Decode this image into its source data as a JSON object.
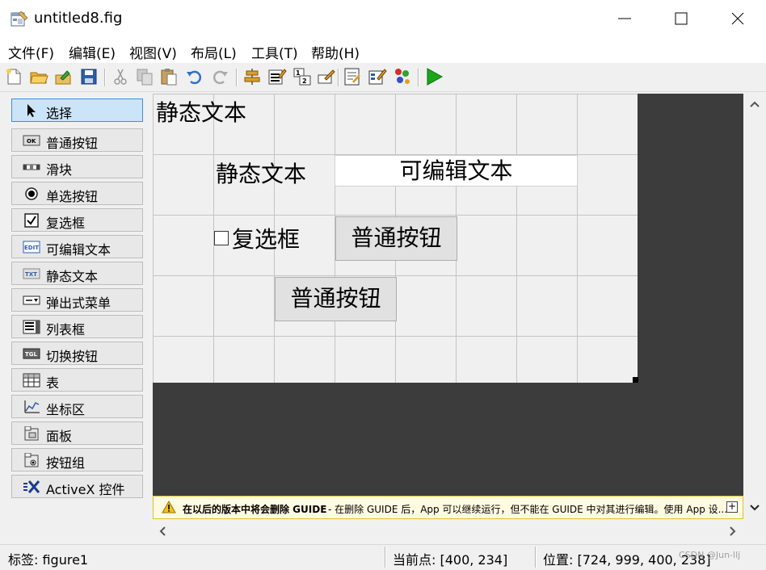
{
  "window": {
    "title": "untitled8.fig"
  },
  "menu": [
    "文件(F)",
    "编辑(E)",
    "视图(V)",
    "布局(L)",
    "工具(T)",
    "帮助(H)"
  ],
  "toolbar_icons": [
    "new-figure-icon",
    "open-icon",
    "export-icon",
    "save-icon",
    "cut-icon",
    "copy-icon",
    "paste-icon",
    "undo-icon",
    "redo-icon",
    "align-icon",
    "menu-editor-icon",
    "tab-order-icon",
    "toolbar-editor-icon",
    "editor-icon",
    "property-inspector-icon",
    "object-browser-icon",
    "run-icon"
  ],
  "palette": {
    "items": [
      {
        "label": "选择",
        "icon": "select-arrow-icon"
      },
      {
        "label": "普通按钮",
        "icon": "pushbutton-icon"
      },
      {
        "label": "滑块",
        "icon": "slider-icon"
      },
      {
        "label": "单选按钮",
        "icon": "radiobutton-icon"
      },
      {
        "label": "复选框",
        "icon": "checkbox-icon"
      },
      {
        "label": "可编辑文本",
        "icon": "edit-text-icon"
      },
      {
        "label": "静态文本",
        "icon": "static-text-icon"
      },
      {
        "label": "弹出式菜单",
        "icon": "popup-menu-icon"
      },
      {
        "label": "列表框",
        "icon": "listbox-icon"
      },
      {
        "label": "切换按钮",
        "icon": "toggle-button-icon"
      },
      {
        "label": "表",
        "icon": "table-icon"
      },
      {
        "label": "坐标区",
        "icon": "axes-icon"
      },
      {
        "label": "面板",
        "icon": "panel-icon"
      },
      {
        "label": "按钮组",
        "icon": "button-group-icon"
      },
      {
        "label": "ActiveX 控件",
        "icon": "activex-icon"
      }
    ],
    "icon_text": {
      "pushbutton": "OK",
      "edit": "EDIT",
      "static": "TXT",
      "toggle": "TGL"
    }
  },
  "figure": {
    "static_text_1": "静态文本",
    "static_text_2": "静态文本",
    "edit_text": "可编辑文本",
    "checkbox": "复选框",
    "pushbutton_1": "普通按钮",
    "pushbutton_2": "普通按钮"
  },
  "warning": {
    "bold": "在以后的版本中将会删除 GUIDE",
    "text": "- 在删除 GUIDE 后，App 可以继续运行，但不能在 GUIDE 中对其进行编辑。使用 App 设...",
    "expand": "+"
  },
  "status": {
    "tag": "标签: figure1",
    "current_point": "当前点:  [400, 234]",
    "position": "位置: [724, 999, 400, 238]"
  },
  "watermark": "CSDN @Jun-llj",
  "colors": {
    "canvas_dark": "#3c3c3c",
    "selected_bg": "#cce4f7",
    "warning_bg": "#fffbe0",
    "run_green": "#1aa51a"
  }
}
